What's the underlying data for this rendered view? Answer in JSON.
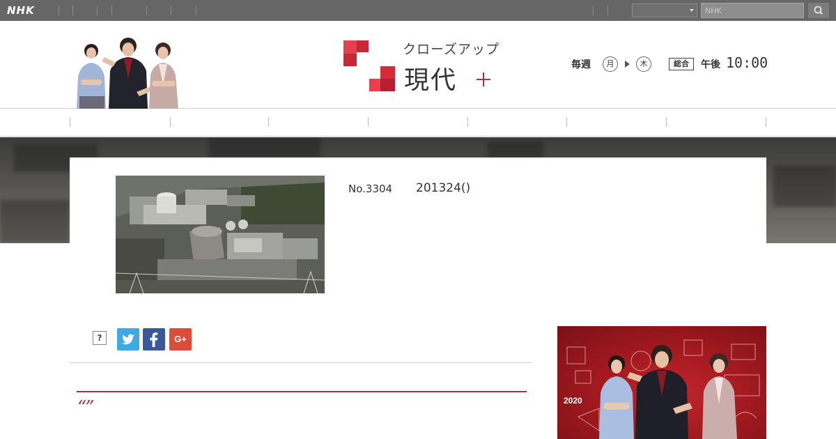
{
  "global_bar": {
    "logo": "NHK",
    "search_placeholder": "NHK"
  },
  "program": {
    "title_top": "クローズアップ",
    "title_main": "現代",
    "schedule": {
      "every_week": "毎週",
      "day_from": "月",
      "day_to": "木",
      "channel": "総合",
      "pm": "午後",
      "time": "10:00"
    }
  },
  "nav": {
    "items": [
      "",
      "",
      "",
      "",
      "",
      "",
      ""
    ]
  },
  "episode": {
    "number": "No.3304",
    "date": "201324()"
  },
  "share": {
    "help": "?",
    "googleplus": "G+"
  },
  "article": {
    "quote": "“”"
  },
  "banner": {
    "year": "2020"
  },
  "colors": {
    "accent": "#a6334a",
    "twitter": "#3fa9e6",
    "facebook": "#3b5998",
    "googleplus": "#dd4b39",
    "global_bar": "#666666"
  }
}
